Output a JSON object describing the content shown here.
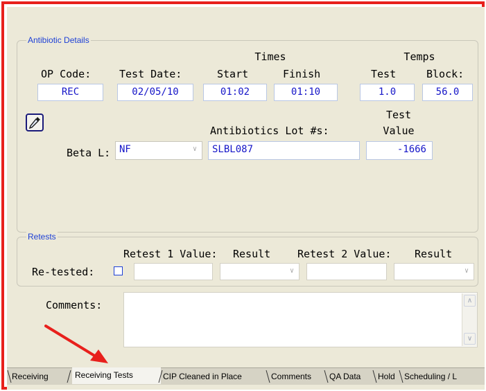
{
  "antibiotic_details": {
    "title": "Antibiotic Details",
    "times_header": "Times",
    "temps_header": "Temps",
    "labels": {
      "op_code": "OP Code:",
      "test_date": "Test Date:",
      "start": "Start",
      "finish": "Finish",
      "temp_test": "Test",
      "temp_block": "Block:",
      "lot": "Antibiotics Lot #s:",
      "test_value_1": "Test",
      "test_value_2": "Value",
      "beta_l": "Beta L:"
    },
    "values": {
      "op_code": "REC",
      "test_date": "02/05/10",
      "start": "01:02",
      "finish": "01:10",
      "temp_test": "1.0",
      "temp_block": "56.0",
      "beta_l": "NF",
      "lot": "SLBL087",
      "test_value": "-1666"
    }
  },
  "retests": {
    "title": "Retests",
    "labels": {
      "retest1": "Retest 1 Value:",
      "result1": "Result",
      "retest2": "Retest 2 Value:",
      "result2": "Result",
      "retested": "Re-tested:"
    },
    "retested_checked": false
  },
  "comments": {
    "label": "Comments:",
    "value": ""
  },
  "tabs": [
    "Receiving",
    "Receiving Tests",
    "CIP Cleaned in Place",
    "Comments",
    "QA Data",
    "Hold",
    "Scheduling / L"
  ],
  "active_tab": "Receiving Tests",
  "colors": {
    "highlight_border": "#e8201c",
    "arrow": "#e8201c",
    "field_text": "#1515c8",
    "group_title": "#1c3fd6"
  }
}
